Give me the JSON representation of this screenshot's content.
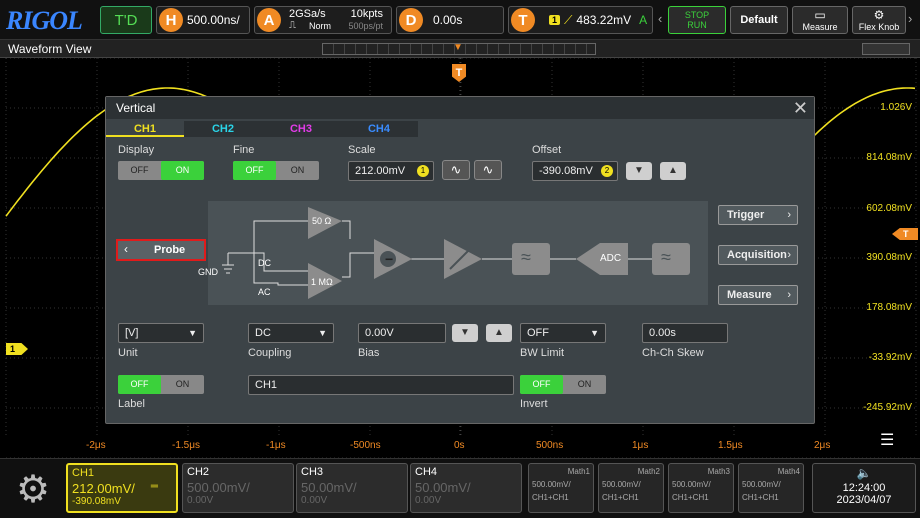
{
  "top": {
    "logo": "RIGOL",
    "mode": "T'D",
    "h_letter": "H",
    "h_value": "500.00ns/",
    "a_letter": "A",
    "sample_rate": "2GSa/s",
    "norm": "Norm",
    "points": "10kpts",
    "per_point": "500ps/pt",
    "d_letter": "D",
    "d_value": "0.00s",
    "t_letter": "T",
    "trig_level": "483.22mV",
    "trig_src": "A",
    "stop_run": "STOP RUN",
    "default": "Default",
    "measure": "Measure",
    "flex_knob": "Flex Knob"
  },
  "titlebar": {
    "title": "Waveform View"
  },
  "axis": {
    "x_ticks": [
      "-2μs",
      "-1.5μs",
      "-1μs",
      "-500ns",
      "0s",
      "500ns",
      "1μs",
      "1.5μs",
      "2μs"
    ],
    "y_ticks": [
      "1.026V",
      "814.08mV",
      "602.08mV",
      "390.08mV",
      "178.08mV",
      "-33.92mV",
      "-245.92mV"
    ],
    "ch1_marker": "1",
    "trig_marker": "T"
  },
  "dialog": {
    "title": "Vertical",
    "tabs": [
      "CH1",
      "CH2",
      "CH3",
      "CH4"
    ],
    "display_label": "Display",
    "fine_label": "Fine",
    "scale_label": "Scale",
    "offset_label": "Offset",
    "off": "OFF",
    "on": "ON",
    "scale_value": "212.00mV",
    "scale_knob": "1",
    "offset_value": "-390.08mV",
    "offset_knob": "2",
    "probe_button": "Probe",
    "gnd": "GND",
    "dc": "DC",
    "ac": "AC",
    "r50": "50 Ω",
    "r1m": "1 MΩ",
    "adc": "ADC",
    "trigger_btn": "Trigger",
    "acquisition_btn": "Acquisition",
    "measure_btn": "Measure",
    "unit_value": "[V]",
    "unit_label": "Unit",
    "coupling_value": "DC",
    "coupling_label": "Coupling",
    "bias_value": "0.00V",
    "bias_label": "Bias",
    "bwlimit_value": "OFF",
    "bwlimit_label": "BW Limit",
    "skew_value": "0.00s",
    "skew_label": "Ch-Ch Skew",
    "label_label": "Label",
    "label_value": "CH1",
    "invert_label": "Invert"
  },
  "bottom": {
    "channels": [
      {
        "name": "CH1",
        "scale": "212.00mV/",
        "offset": "-390.08mV"
      },
      {
        "name": "CH2",
        "scale": "500.00mV/",
        "offset": "0.00V"
      },
      {
        "name": "CH3",
        "scale": "50.00mV/",
        "offset": "0.00V"
      },
      {
        "name": "CH4",
        "scale": "50.00mV/",
        "offset": "0.00V"
      }
    ],
    "maths": [
      {
        "name": "Math1",
        "scale": "500.00mV/",
        "src": "CH1+CH1"
      },
      {
        "name": "Math2",
        "scale": "500.00mV/",
        "src": "CH1+CH1"
      },
      {
        "name": "Math3",
        "scale": "500.00mV/",
        "src": "CH1+CH1"
      },
      {
        "name": "Math4",
        "scale": "500.00mV/",
        "src": "CH1+CH1"
      }
    ],
    "time": "12:24:00",
    "date": "2023/04/07"
  },
  "colors": {
    "ch1": "#f0e020",
    "ch2": "#2ad4e8",
    "ch3": "#e23ce8",
    "ch4": "#3a8cff",
    "accent": "#f08a24",
    "on": "#3bd13b"
  }
}
